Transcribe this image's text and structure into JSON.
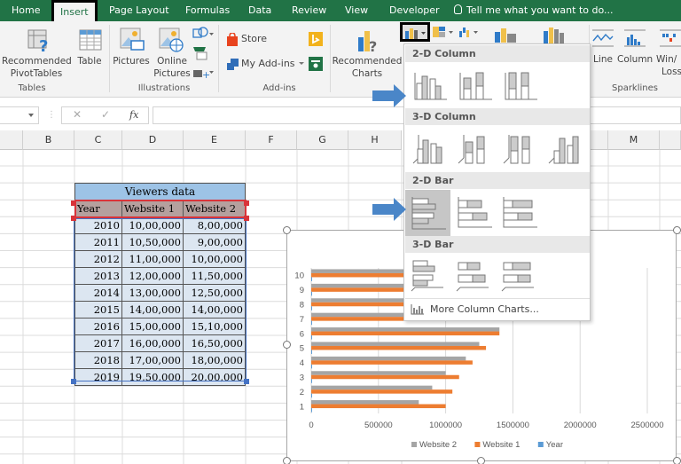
{
  "tabs": [
    {
      "label": "Home",
      "active": false
    },
    {
      "label": "Insert",
      "active": true
    },
    {
      "label": "Page Layout",
      "active": false
    },
    {
      "label": "Formulas",
      "active": false
    },
    {
      "label": "Data",
      "active": false
    },
    {
      "label": "Review",
      "active": false
    },
    {
      "label": "View",
      "active": false
    },
    {
      "label": "Developer",
      "active": false
    }
  ],
  "tell_me": "Tell me what you want to do...",
  "ribbon": {
    "recommended_pivottables": [
      "Recommended",
      "PivotTables"
    ],
    "table": "Table",
    "pictures": "Pictures",
    "online_pictures": [
      "Online",
      "Pictures"
    ],
    "store": "Store",
    "my_addins": "My Add-ins",
    "recommended_charts": [
      "Recommended",
      "Charts"
    ],
    "sparkline_line": "Line",
    "sparkline_column": "Column",
    "sparkline_winloss": [
      "Win/",
      "Loss"
    ],
    "groups": {
      "tables": "Tables",
      "illustrations": "Illustrations",
      "addins": "Add-ins",
      "sparklines": "Sparklines"
    }
  },
  "formula_bar": {
    "name_box": "",
    "cancel_icon": "✕",
    "enter_icon": "✓",
    "fx": "fx",
    "value": ""
  },
  "columns": [
    "B",
    "C",
    "D",
    "E",
    "F",
    "G",
    "H",
    "M"
  ],
  "table": {
    "title": "Viewers data",
    "headers": [
      "Year",
      "Website 1",
      "Website 2"
    ],
    "rows": [
      [
        "2010",
        "10,00,000",
        "8,00,000"
      ],
      [
        "2011",
        "10,50,000",
        "9,00,000"
      ],
      [
        "2012",
        "11,00,000",
        "10,00,000"
      ],
      [
        "2013",
        "12,00,000",
        "11,50,000"
      ],
      [
        "2014",
        "13,00,000",
        "12,50,000"
      ],
      [
        "2015",
        "14,00,000",
        "14,00,000"
      ],
      [
        "2016",
        "15,00,000",
        "15,10,000"
      ],
      [
        "2017",
        "16,00,000",
        "16,50,000"
      ],
      [
        "2018",
        "17,00,000",
        "18,00,000"
      ],
      [
        "2019",
        "19,50,000",
        "20,00,000"
      ]
    ]
  },
  "dropdown": {
    "sections": [
      "2-D Column",
      "3-D Column",
      "2-D Bar",
      "3-D Bar"
    ],
    "more": "More Column Charts...",
    "selected": "2-D Bar / Clustered Bar"
  },
  "colors": {
    "excel_green": "#217346",
    "website1": "#ed7d31",
    "website2": "#a5a5a5",
    "year": "#5b9bd5",
    "arrow": "#4a86c8"
  },
  "chart_data": {
    "type": "bar",
    "orientation": "horizontal",
    "categories": [
      "1",
      "2",
      "3",
      "4",
      "5",
      "6",
      "7",
      "8",
      "9",
      "10"
    ],
    "series": [
      {
        "name": "Year",
        "color": "#5b9bd5",
        "values": [
          2010,
          2011,
          2012,
          2013,
          2014,
          2015,
          2016,
          2017,
          2018,
          2019
        ]
      },
      {
        "name": "Website 1",
        "color": "#ed7d31",
        "values": [
          1000000,
          1050000,
          1100000,
          1200000,
          1300000,
          1400000,
          1500000,
          1600000,
          1700000,
          1950000
        ]
      },
      {
        "name": "Website 2",
        "color": "#a5a5a5",
        "values": [
          800000,
          900000,
          1000000,
          1150000,
          1250000,
          1400000,
          1510000,
          1650000,
          1800000,
          2000000
        ]
      }
    ],
    "xaxis_ticks": [
      "0",
      "500000",
      "1000000",
      "1500000",
      "2000000",
      "2500000"
    ],
    "xlim": [
      0,
      2500000
    ],
    "legend": [
      "Website 2",
      "Website 1",
      "Year"
    ],
    "legend_position": "bottom",
    "grid": true,
    "title": "",
    "xlabel": "",
    "ylabel": ""
  }
}
